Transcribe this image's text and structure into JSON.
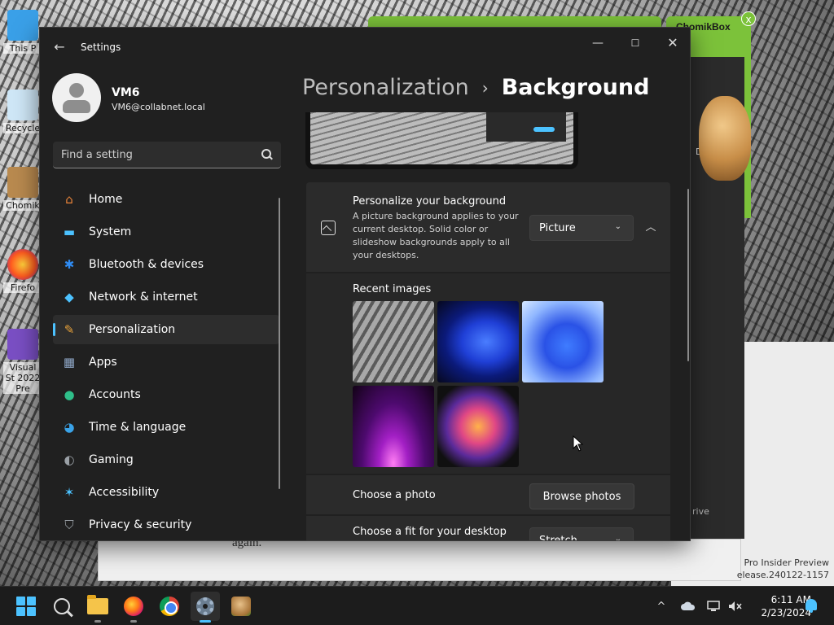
{
  "desktop": {
    "icons": [
      {
        "label": "This P",
        "name": "this-pc"
      },
      {
        "label": "Recycle",
        "name": "recycle-bin"
      },
      {
        "label": "Chomik",
        "name": "chomik"
      },
      {
        "label": "Firefo",
        "name": "firefox"
      },
      {
        "label": "Visual St 2022 Pre",
        "name": "visual-studio"
      }
    ],
    "chomik_window_title": "ChomikBox",
    "bg_panel_text_1": "De",
    "bg_panel_text_2": "rive",
    "bg_paper_text": "again.",
    "watermark_line_1": "Pro Insider Preview",
    "watermark_line_2": "elease.240122-1157"
  },
  "window": {
    "title": "Settings",
    "controls": {
      "minimize": "—",
      "maximize": "☐",
      "close": "✕"
    }
  },
  "user": {
    "name": "VM6",
    "email": "VM6@collabnet.local"
  },
  "search": {
    "placeholder": "Find a setting"
  },
  "sidebar": {
    "items": [
      {
        "label": "Home",
        "icon": "home-icon",
        "glyph": "⌂",
        "color": "#e8833a"
      },
      {
        "label": "System",
        "icon": "system-icon",
        "glyph": "▬",
        "color": "#4cc2ff"
      },
      {
        "label": "Bluetooth & devices",
        "icon": "bluetooth-icon",
        "glyph": "✱",
        "color": "#2f8cf4"
      },
      {
        "label": "Network & internet",
        "icon": "network-icon",
        "glyph": "◆",
        "color": "#4cc2ff"
      },
      {
        "label": "Personalization",
        "icon": "brush-icon",
        "glyph": "✎",
        "color": "#e8a23a"
      },
      {
        "label": "Apps",
        "icon": "apps-icon",
        "glyph": "▦",
        "color": "#8fa7c7"
      },
      {
        "label": "Accounts",
        "icon": "accounts-icon",
        "glyph": "●",
        "color": "#2fbf8a"
      },
      {
        "label": "Time & language",
        "icon": "globe-icon",
        "glyph": "◕",
        "color": "#3aa3e8"
      },
      {
        "label": "Gaming",
        "icon": "gaming-icon",
        "glyph": "◐",
        "color": "#9aa0a6"
      },
      {
        "label": "Accessibility",
        "icon": "accessibility-icon",
        "glyph": "✶",
        "color": "#4cc2ff"
      },
      {
        "label": "Privacy & security",
        "icon": "shield-icon",
        "glyph": "⛉",
        "color": "#9aa0a6"
      }
    ],
    "active_index": 4
  },
  "breadcrumb": {
    "parent": "Personalization",
    "separator": "›",
    "current": "Background"
  },
  "personalize": {
    "heading": "Personalize your background",
    "description": "A picture background applies to your current desktop. Solid color or slideshow backgrounds apply to all your desktops.",
    "selected": "Picture"
  },
  "recent": {
    "heading": "Recent images",
    "images": [
      "manga-thumbnail",
      "blue-bloom-dark-thumbnail",
      "blue-bloom-light-thumbnail",
      "purple-glow-thumbnail",
      "colorful-ribbon-thumbnail"
    ]
  },
  "choose_photo": {
    "label": "Choose a photo",
    "button": "Browse photos"
  },
  "choose_fit": {
    "label": "Choose a fit for your desktop",
    "selected": "Stretch"
  },
  "taskbar": {
    "apps": [
      "start-button",
      "search-button",
      "file-explorer-button",
      "firefox-button",
      "chrome-button",
      "settings-button",
      "chomikbox-button"
    ],
    "tray_chevron": "^",
    "time": "6:11 AM",
    "date": "2/23/2024"
  },
  "colors": {
    "accent": "#4cc2ff",
    "window_bg": "#202020",
    "card_bg": "#2b2b2b"
  }
}
